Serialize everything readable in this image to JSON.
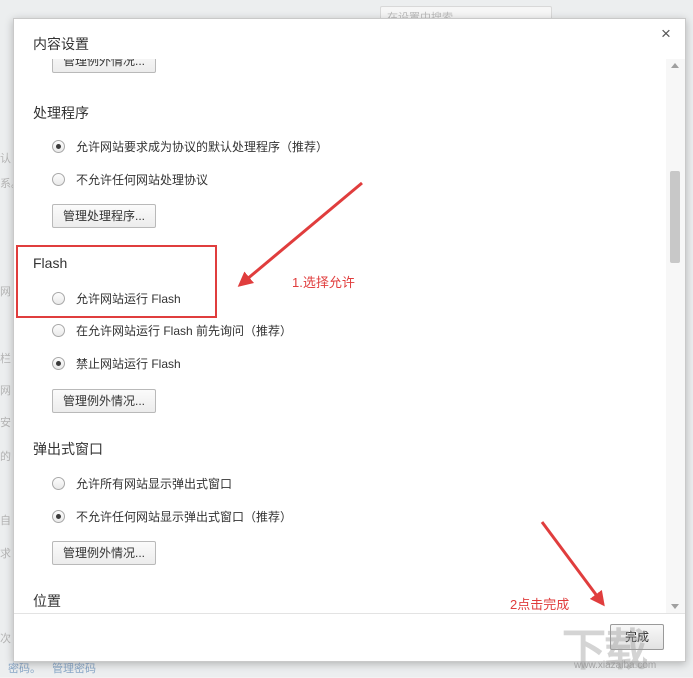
{
  "background": {
    "search_placeholder": "在设置中搜索",
    "edge_fragments": [
      "认",
      "系。",
      "网",
      "栏",
      "网",
      "安",
      "的",
      "自",
      "求",
      "次"
    ],
    "bottom_links": [
      "密码。",
      "管理密码"
    ]
  },
  "dialog": {
    "title": "内容设置",
    "close_symbol": "×",
    "top_button_label": "管理例外情况...",
    "sections": {
      "handlers": {
        "title": "处理程序",
        "options": [
          {
            "label": "允许网站要求成为协议的默认处理程序（推荐）",
            "checked": true
          },
          {
            "label": "不允许任何网站处理协议",
            "checked": false
          }
        ],
        "button": "管理处理程序..."
      },
      "flash": {
        "title": "Flash",
        "options": [
          {
            "label": "允许网站运行 Flash",
            "checked": false
          },
          {
            "label": "在允许网站运行 Flash 前先询问（推荐）",
            "checked": false
          },
          {
            "label": "禁止网站运行 Flash",
            "checked": true
          }
        ],
        "button": "管理例外情况..."
      },
      "popups": {
        "title": "弹出式窗口",
        "options": [
          {
            "label": "允许所有网站显示弹出式窗口",
            "checked": false
          },
          {
            "label": "不允许任何网站显示弹出式窗口（推荐）",
            "checked": true
          }
        ],
        "button": "管理例外情况..."
      },
      "location": {
        "title": "位置"
      }
    },
    "done_label": "完成"
  },
  "annotations": {
    "step1": "1.选择允许",
    "step2": "2点击完成",
    "accent_color": "#e03d3d"
  },
  "watermark": {
    "text": "下载",
    "url": "www.xiazaiba.com"
  }
}
